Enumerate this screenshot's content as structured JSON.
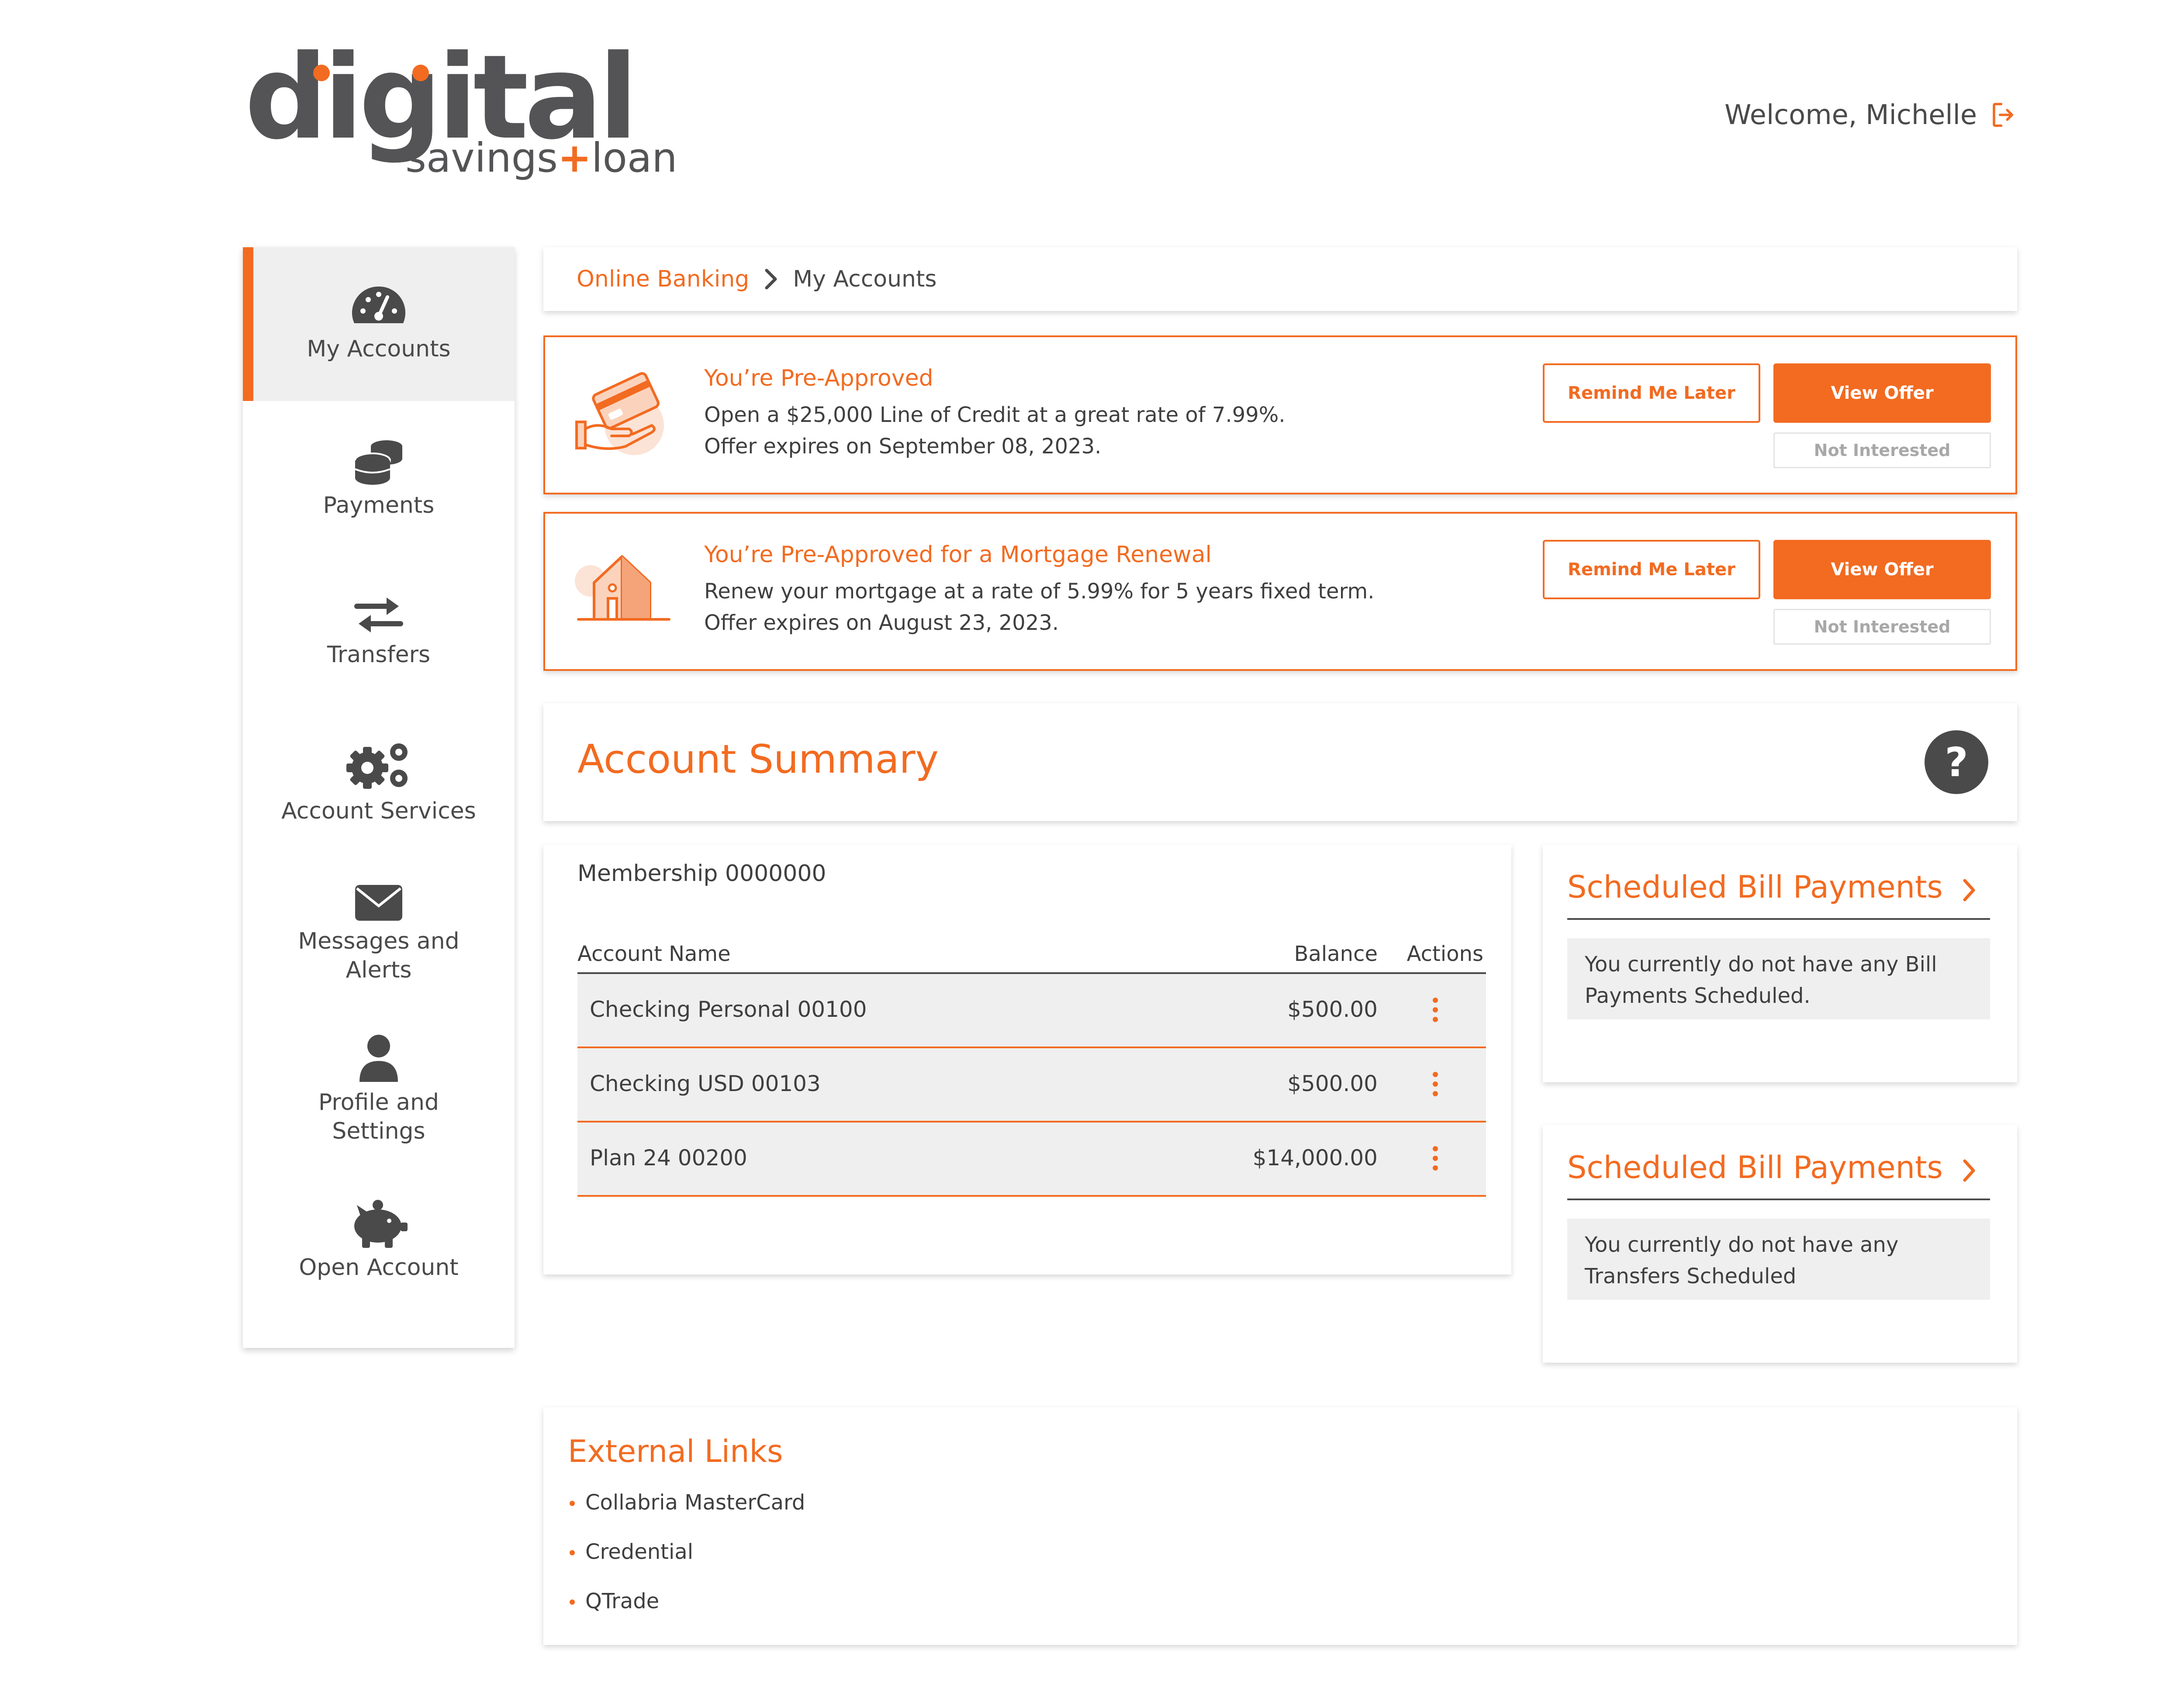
{
  "brand": {
    "word": "digital",
    "sub_left": "savings",
    "sub_plus": "+",
    "sub_right": "loan",
    "accent": "#f26b21",
    "text_dark": "#545456"
  },
  "header": {
    "welcome": "Welcome, Michelle",
    "logout_icon": "logout-icon"
  },
  "sidebar": {
    "items": [
      {
        "label": "My Accounts",
        "icon": "speedometer-icon",
        "active": true
      },
      {
        "label": "Payments",
        "icon": "coins-icon"
      },
      {
        "label": "Transfers",
        "icon": "transfer-arrows-icon"
      },
      {
        "label": "Account Services",
        "icon": "gears-icon"
      },
      {
        "label": "Messages and Alerts",
        "icon": "envelope-icon"
      },
      {
        "label": "Profile and Settings",
        "icon": "user-icon"
      },
      {
        "label": "Open Account",
        "icon": "piggy-bank-icon"
      }
    ]
  },
  "breadcrumb": {
    "root": "Online Banking",
    "current": "My Accounts"
  },
  "offers": [
    {
      "title": "You’re Pre-Approved",
      "line1": "Open a $25,000 Line of Credit at a great rate of 7.99%.",
      "line2": "Offer expires on September 08, 2023.",
      "icon": "credit-card-hand-icon",
      "remind_label": "Remind Me Later",
      "view_label": "View Offer",
      "not_label": "Not Interested"
    },
    {
      "title": "You’re Pre-Approved for a Mortgage Renewal",
      "line1": "Renew your mortgage at a rate of 5.99% for 5 years fixed term.",
      "line2": "Offer expires on August 23, 2023.",
      "icon": "house-icon",
      "remind_label": "Remind Me Later",
      "view_label": "View Offer",
      "not_label": "Not Interested"
    }
  ],
  "summary": {
    "title": "Account Summary",
    "help_label": "?"
  },
  "accounts": {
    "membership": "Membership 0000000",
    "headers": {
      "name": "Account Name",
      "balance": "Balance",
      "actions": "Actions"
    },
    "rows": [
      {
        "name": "Checking Personal 00100",
        "balance": "$500.00"
      },
      {
        "name": "Checking USD 00103",
        "balance": "$500.00"
      },
      {
        "name": "Plan 24 00200",
        "balance": "$14,000.00"
      }
    ]
  },
  "side_panels": [
    {
      "title": "Scheduled Bill Payments",
      "message": "You currently do not have any Bill Payments Scheduled."
    },
    {
      "title": "Scheduled Bill Payments",
      "message": "You currently do not have any Transfers Scheduled"
    }
  ],
  "external": {
    "title": "External Links",
    "links": [
      "Collabria MasterCard",
      "Credential",
      "QTrade"
    ]
  }
}
